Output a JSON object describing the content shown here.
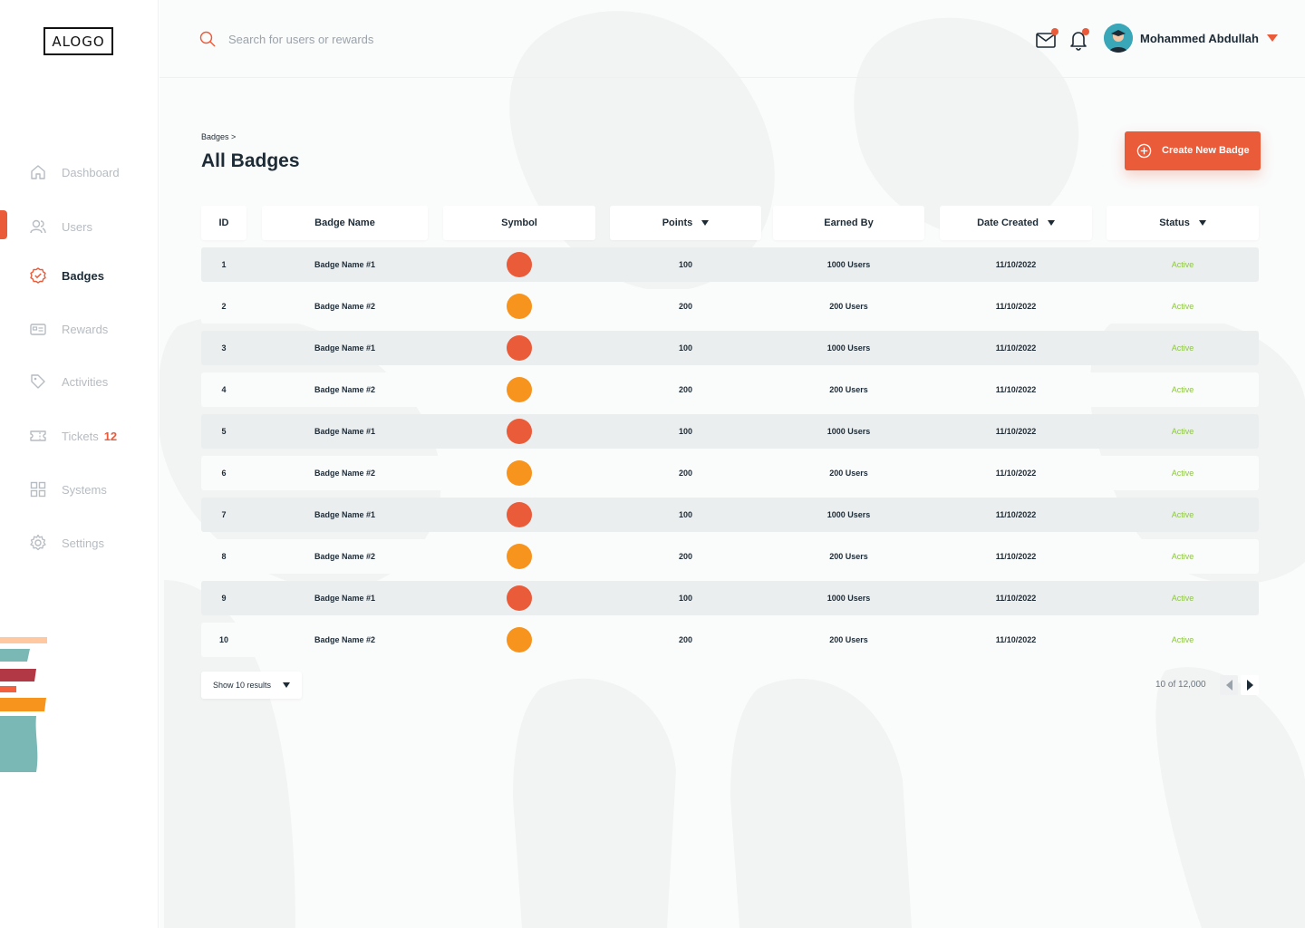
{
  "brand": {
    "logo_text": "ALOGO"
  },
  "sidebar": {
    "items": [
      {
        "label": "Dashboard",
        "icon": "home-icon",
        "active": false
      },
      {
        "label": "Users",
        "icon": "users-icon",
        "active": false
      },
      {
        "label": "Badges",
        "icon": "badge-icon",
        "active": true
      },
      {
        "label": "Rewards",
        "icon": "rewards-icon",
        "active": false
      },
      {
        "label": "Activities",
        "icon": "tag-icon",
        "active": false
      },
      {
        "label": "Tickets",
        "icon": "ticket-icon",
        "active": false,
        "badge": "12"
      },
      {
        "label": "Systems",
        "icon": "grid-icon",
        "active": false
      },
      {
        "label": "Settings",
        "icon": "gear-icon",
        "active": false
      }
    ]
  },
  "header": {
    "search_placeholder": "Search for users or rewards",
    "user_name": "Mohammed Abdullah"
  },
  "page": {
    "breadcrumb": "Badges >",
    "title": "All Badges",
    "create_button": "Create New Badge"
  },
  "table": {
    "columns": [
      {
        "label": "ID",
        "sortable": false
      },
      {
        "label": "Badge Name",
        "sortable": false
      },
      {
        "label": "Symbol",
        "sortable": false
      },
      {
        "label": "Points",
        "sortable": true
      },
      {
        "label": "Earned By",
        "sortable": false
      },
      {
        "label": "Date Created",
        "sortable": true
      },
      {
        "label": "Status",
        "sortable": true
      }
    ],
    "rows": [
      {
        "id": "1",
        "name": "Badge Name #1",
        "symbol_color": "#ea5b3a",
        "points": "100",
        "earned_by": "1000 Users",
        "date": "11/10/2022",
        "status": "Active"
      },
      {
        "id": "2",
        "name": "Badge Name #2",
        "symbol_color": "#f7941d",
        "points": "200",
        "earned_by": "200 Users",
        "date": "11/10/2022",
        "status": "Active"
      },
      {
        "id": "3",
        "name": "Badge Name #1",
        "symbol_color": "#ea5b3a",
        "points": "100",
        "earned_by": "1000 Users",
        "date": "11/10/2022",
        "status": "Active"
      },
      {
        "id": "4",
        "name": "Badge Name #2",
        "symbol_color": "#f7941d",
        "points": "200",
        "earned_by": "200 Users",
        "date": "11/10/2022",
        "status": "Active"
      },
      {
        "id": "5",
        "name": "Badge Name #1",
        "symbol_color": "#ea5b3a",
        "points": "100",
        "earned_by": "1000 Users",
        "date": "11/10/2022",
        "status": "Active"
      },
      {
        "id": "6",
        "name": "Badge Name #2",
        "symbol_color": "#f7941d",
        "points": "200",
        "earned_by": "200 Users",
        "date": "11/10/2022",
        "status": "Active"
      },
      {
        "id": "7",
        "name": "Badge Name #1",
        "symbol_color": "#ea5b3a",
        "points": "100",
        "earned_by": "1000 Users",
        "date": "11/10/2022",
        "status": "Active"
      },
      {
        "id": "8",
        "name": "Badge Name #2",
        "symbol_color": "#f7941d",
        "points": "200",
        "earned_by": "200 Users",
        "date": "11/10/2022",
        "status": "Active"
      },
      {
        "id": "9",
        "name": "Badge Name #1",
        "symbol_color": "#ea5b3a",
        "points": "100",
        "earned_by": "1000 Users",
        "date": "11/10/2022",
        "status": "Active"
      },
      {
        "id": "10",
        "name": "Badge Name #2",
        "symbol_color": "#f7941d",
        "points": "200",
        "earned_by": "200 Users",
        "date": "11/10/2022",
        "status": "Active"
      }
    ]
  },
  "footer": {
    "show_results": "Show 10 results",
    "pager_text": "10 of 12,000"
  },
  "colors": {
    "accent": "#ea5b3a",
    "orange": "#f7941d",
    "status_active": "#8dc63f",
    "text_dark": "#1d2b36"
  }
}
